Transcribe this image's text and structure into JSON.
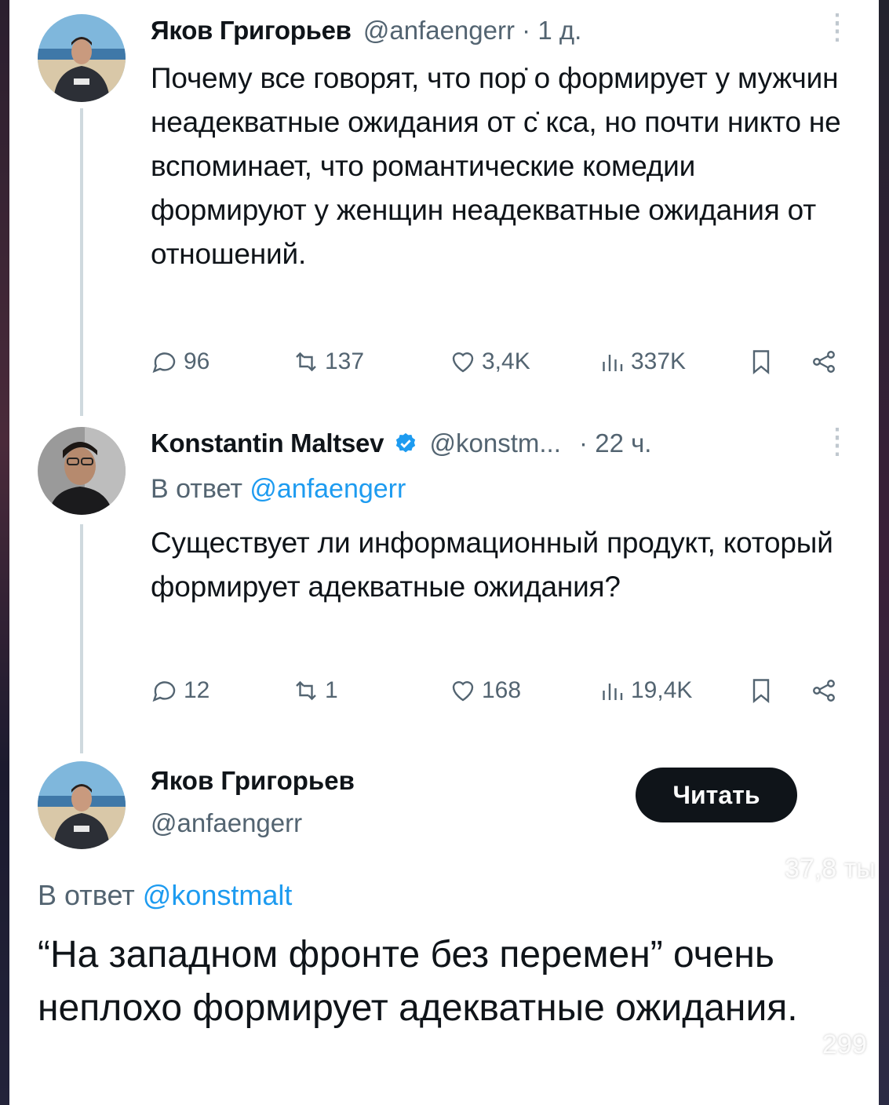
{
  "tweet1": {
    "name": "Яков Григорьев",
    "handle": "@anfaengerr",
    "dot": "·",
    "time": "1 д.",
    "text": "Почему все говорят, что пор̇ о формирует у мужчин неадекватные ожидания от с̇ кса, но почти никто не вспоминает, что романтические комедии формируют у женщин неадекватные ожидания от отношений.",
    "replies": "96",
    "reposts": "137",
    "likes": "3,4K",
    "views": "337K"
  },
  "tweet2": {
    "name": "Konstantin Maltsev",
    "handle": "@konstm...",
    "dot": "·",
    "time": "22 ч.",
    "reply_prefix": "В ответ",
    "reply_handle": "@anfaengerr",
    "text": "Существует ли информационный продукт, который формирует адекватные ожидания?",
    "replies": "12",
    "reposts": "1",
    "likes": "168",
    "views": "19,4K"
  },
  "tweet3": {
    "name": "Яков Григорьев",
    "handle": "@anfaengerr",
    "follow_label": "Читать",
    "reply_prefix": "В ответ",
    "reply_handle": "@konstmalt",
    "text": "“На западном фронте без перемен” очень неплохо формирует адекватные ожидания."
  },
  "overlay": {
    "likes_count": "37,8 ты",
    "comments_count": "299"
  },
  "colors": {
    "link": "#1d9bf0",
    "muted": "#536471",
    "verified": "#1d9bf0",
    "button": "#0f1419"
  }
}
